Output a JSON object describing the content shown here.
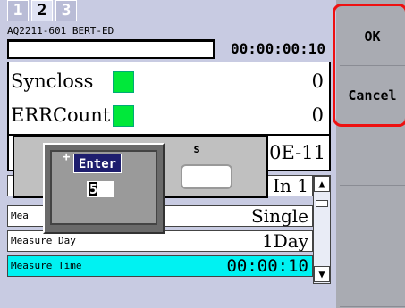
{
  "tabs": [
    "1",
    "2",
    "3"
  ],
  "header": {
    "device": "AQ2211-601 BERT-ED",
    "elapsed": "00:00:00:10"
  },
  "status": [
    {
      "label": "Syncloss",
      "value": "0",
      "led_color": "#00e83a"
    },
    {
      "label": "ERRCount",
      "value": "0",
      "led_color": "#00e83a"
    }
  ],
  "ber": {
    "value": "00E-11"
  },
  "list": {
    "partial_top_label": "In 1",
    "rows": [
      {
        "label": "Mea",
        "value": "Single"
      },
      {
        "label": "Measure Day",
        "value": "1Day"
      },
      {
        "label": "Measure Time",
        "value": "00:00:10"
      }
    ]
  },
  "dialog": {
    "s_label": "s",
    "enter_label": "Enter",
    "plus": "+",
    "value": "5"
  },
  "side": {
    "ok": "OK",
    "cancel": "Cancel"
  },
  "colors": {
    "accent": "#00f2f2",
    "focus": "#e11111",
    "led": "#00e83a"
  }
}
